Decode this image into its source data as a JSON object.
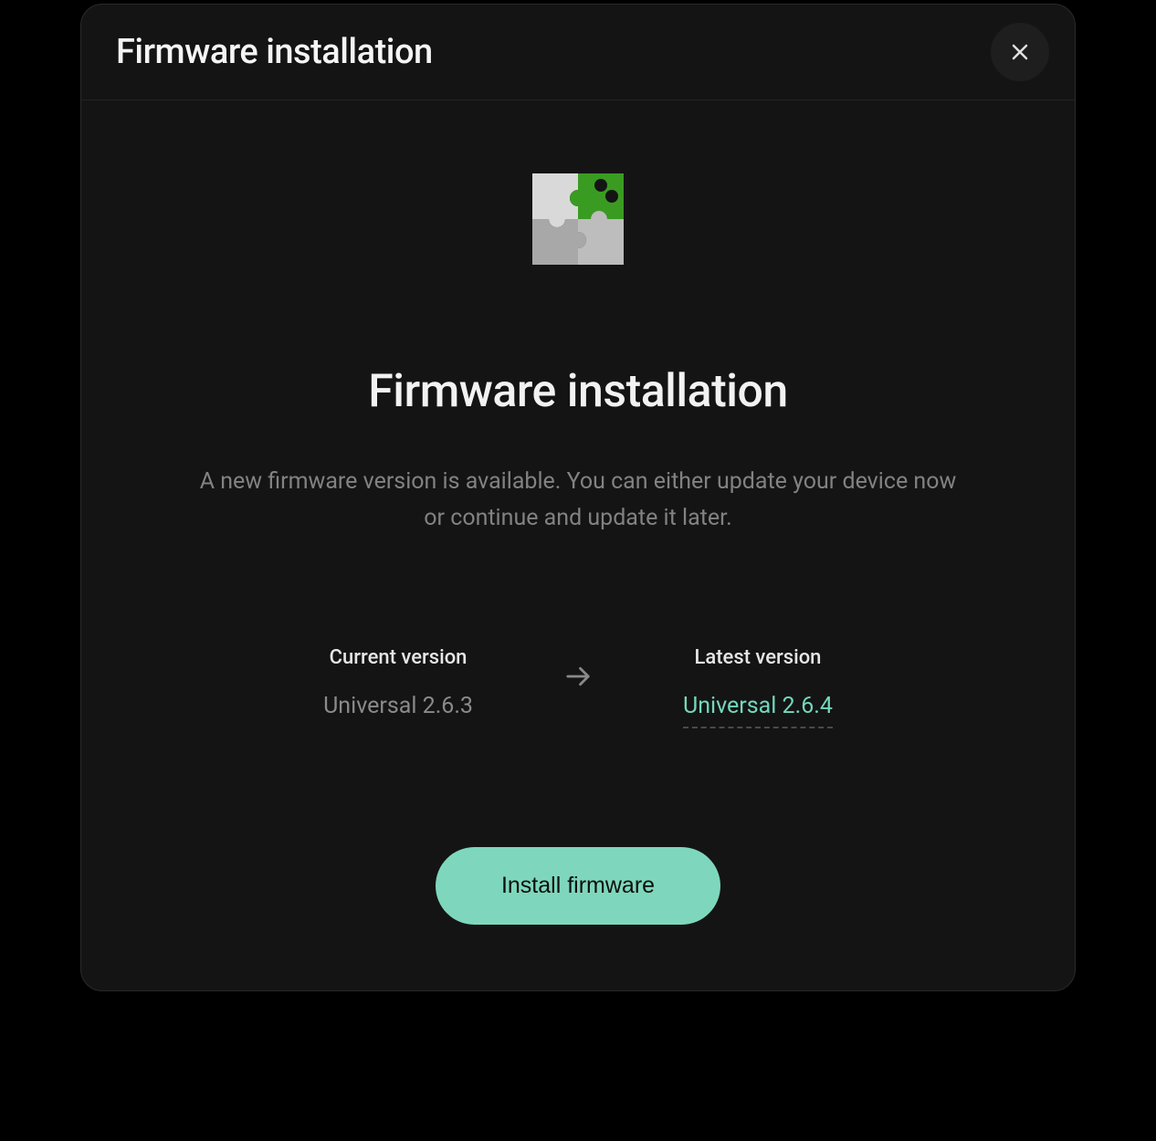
{
  "header": {
    "title": "Firmware installation"
  },
  "main": {
    "heading": "Firmware installation",
    "description": "A new firmware version is available. You can either update your device now or continue and update it later."
  },
  "versions": {
    "current_label": "Current version",
    "current_value": "Universal 2.6.3",
    "latest_label": "Latest version",
    "latest_value": "Universal 2.6.4"
  },
  "actions": {
    "install_label": "Install firmware"
  }
}
